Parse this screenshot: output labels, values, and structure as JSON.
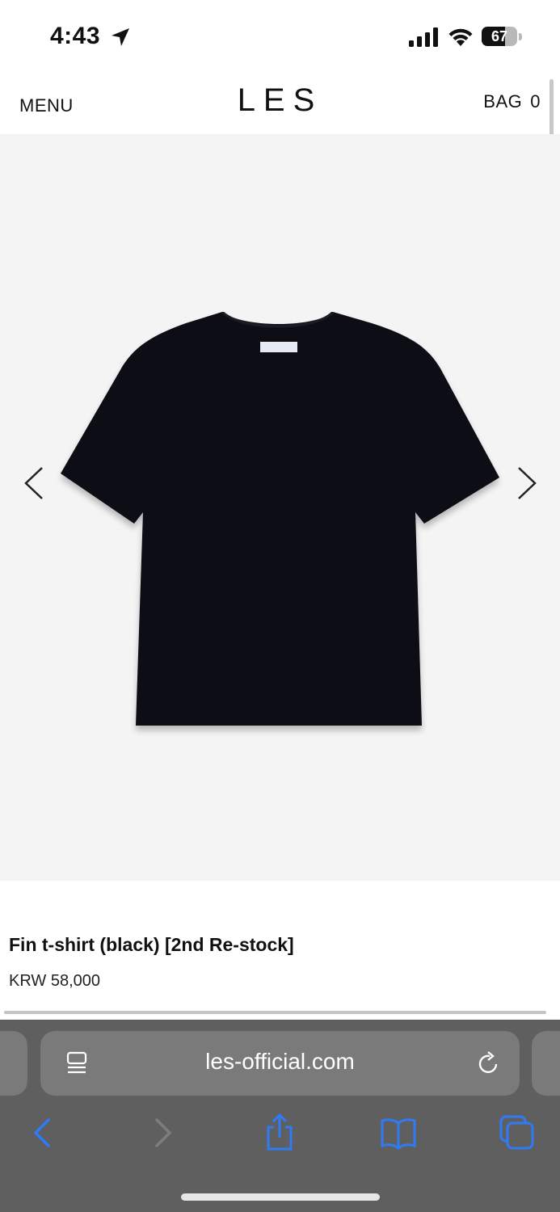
{
  "status_bar": {
    "time": "4:43",
    "battery_percent": "67",
    "battery_level": 0.67,
    "icons": [
      "location-arrow-icon",
      "cellular-signal-icon",
      "wifi-icon",
      "battery-icon"
    ]
  },
  "header": {
    "menu_label": "MENU",
    "logo": "LES",
    "bag_label": "BAG",
    "bag_count": "0"
  },
  "gallery": {
    "image": "black t-shirt product photo",
    "background_color": "#f4f4f4",
    "prev_icon": "chevron-left-icon",
    "next_icon": "chevron-right-icon"
  },
  "product": {
    "name": "Fin t-shirt (black) [2nd Re-stock]",
    "price": "KRW 58,000"
  },
  "browser": {
    "url": "les-official.com",
    "icons": [
      "page-menu-icon",
      "reload-icon",
      "back-icon",
      "forward-icon",
      "share-icon",
      "bookmarks-icon",
      "tabs-icon"
    ],
    "accent_color": "#2f7bf5"
  },
  "colors": {
    "chrome_bg": "#5f5f5f",
    "url_bar_bg": "#7a7a7a",
    "shirt": "#0b0d14"
  }
}
